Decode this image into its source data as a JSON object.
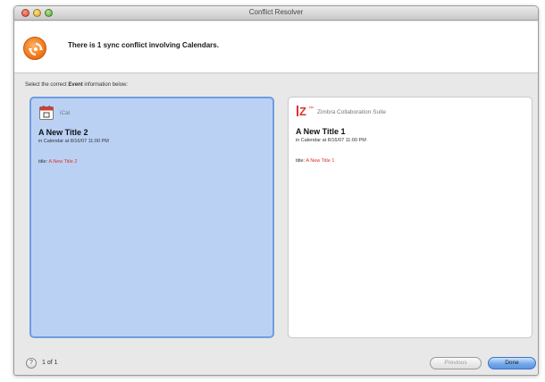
{
  "window": {
    "title": "Conflict Resolver"
  },
  "header": {
    "message": "There is 1 sync conflict involving Calendars."
  },
  "instruction": {
    "prefix": "Select the correct ",
    "emphasis": "Event",
    "suffix": " information below:"
  },
  "options": [
    {
      "app_name": "iCal",
      "icon": "ical-calendar-icon",
      "title": "A New Title 2",
      "subtitle": "in Calendar at 8/16/07 11:00 PM",
      "field_label": "title:",
      "field_value": "A New Title 2",
      "selected": true
    },
    {
      "app_name": "Zimbra Collaboration Suite",
      "icon": "zimbra-logo-icon",
      "title": "A New Title 1",
      "subtitle": "in Calendar at 8/16/07 11:00 PM",
      "field_label": "title:",
      "field_value": "A New Title 1",
      "selected": false
    }
  ],
  "footer": {
    "help_label": "?",
    "page_count": "1 of 1",
    "previous_label": "Previous",
    "done_label": "Done"
  },
  "colors": {
    "selected_panel": "#bad1f4",
    "selected_border": "#6f9ce0",
    "field_value": "#e0302a",
    "sync_icon": "#f07a1a"
  }
}
